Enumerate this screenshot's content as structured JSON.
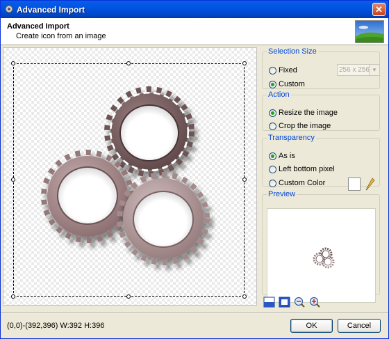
{
  "window": {
    "title": "Advanced Import",
    "close_glyph": "✕"
  },
  "header": {
    "title": "Advanced Import",
    "subtitle": "Create icon from an image"
  },
  "selection_size": {
    "legend": "Selection Size",
    "options": [
      {
        "label": "Fixed",
        "selected": false
      },
      {
        "label": "Custom",
        "selected": true
      }
    ],
    "size_value": "256 x 256"
  },
  "action": {
    "legend": "Action",
    "options": [
      {
        "label": "Resize the image",
        "selected": true
      },
      {
        "label": "Crop the image",
        "selected": false
      }
    ]
  },
  "transparency": {
    "legend": "Transparency",
    "options": [
      {
        "label": "As is",
        "selected": true
      },
      {
        "label": "Left bottom pixel",
        "selected": false
      },
      {
        "label": "Custom Color",
        "selected": false
      }
    ],
    "custom_color": "#ffffff"
  },
  "preview": {
    "legend": "Preview"
  },
  "tools": [
    "fit-window-icon",
    "actual-size-icon",
    "zoom-out-icon",
    "zoom-in-icon"
  ],
  "status": "(0,0)-(392,396) W:392 H:396",
  "buttons": {
    "ok": "OK",
    "cancel": "Cancel"
  },
  "colors": {
    "accent": "#0046d5",
    "titlebar": "#0054e3",
    "gear_dark": "#7a5f60",
    "gear_light": "#a58a8c"
  }
}
